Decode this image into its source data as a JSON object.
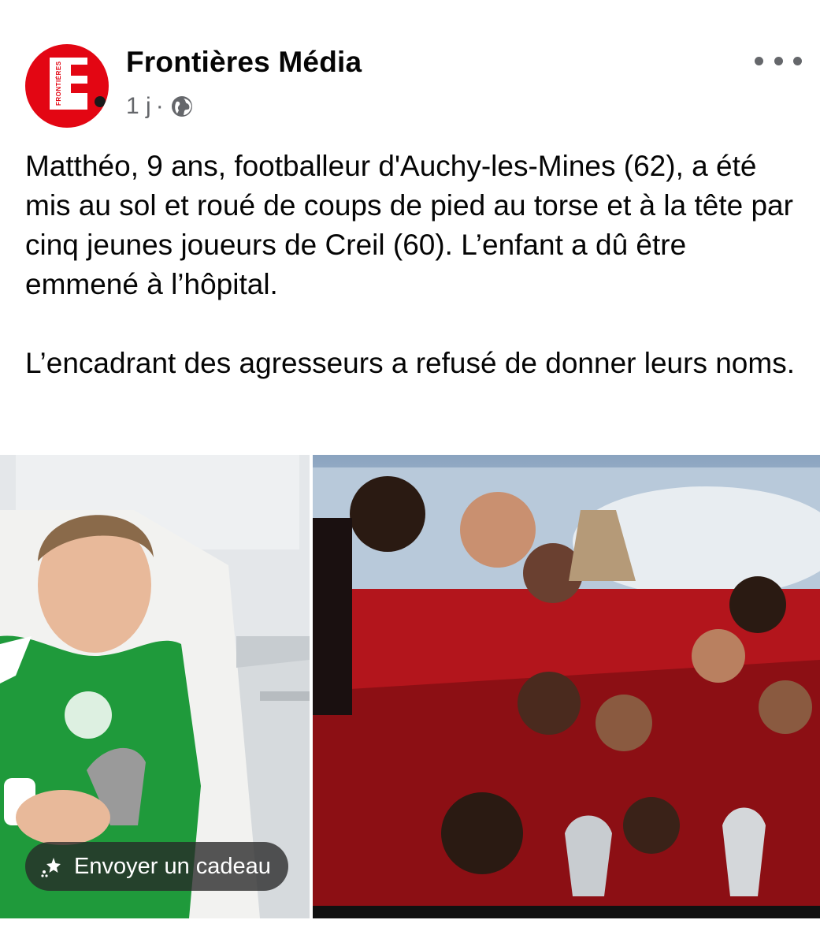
{
  "post": {
    "page_name": "Frontières Média",
    "time": "1 j",
    "separator": "·",
    "audience_icon": "globe-icon",
    "more_icon": "more-horizontal-icon",
    "logo_text": "FRONTIÈRES",
    "brand_color": "#e30613",
    "paragraphs": [
      "Matthéo, 9 ans, footballeur d'Auchy-les-Mines (62), a été mis au sol et roué de coups de pied au torse et à la tête par cinq jeunes joueurs de Creil (60). L’enfant a dû être emmené à l’hôpital.",
      "L’encadrant des agresseurs a refusé de donner leurs noms."
    ],
    "gift_button": {
      "label": "Envoyer un cadeau",
      "icon": "gift-sparkle-icon"
    }
  }
}
